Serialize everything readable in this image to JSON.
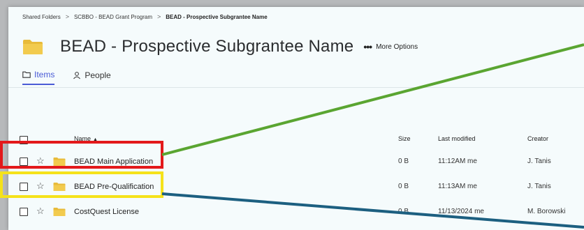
{
  "breadcrumb": {
    "items": [
      "Shared Folders",
      "SCBBO - BEAD Grant Program",
      "BEAD - Prospective Subgrantee Name"
    ],
    "separator": ">"
  },
  "title": "BEAD - Prospective Subgrantee Name",
  "more_options": {
    "dots": "•••",
    "label": "More Options"
  },
  "tabs": [
    {
      "label": "Items",
      "icon": "folder-outline-icon",
      "active": true
    },
    {
      "label": "People",
      "icon": "person-icon",
      "active": false
    }
  ],
  "table": {
    "columns": {
      "name": "Name",
      "sort_indicator": "▲",
      "size": "Size",
      "modified": "Last modified",
      "creator": "Creator"
    },
    "rows": [
      {
        "name": "BEAD Main Application",
        "size": "0 B",
        "modified": "11:12AM me",
        "creator": "J. Tanis"
      },
      {
        "name": "BEAD Pre-Qualification",
        "size": "0 B",
        "modified": "11:13AM me",
        "creator": "J. Tanis"
      },
      {
        "name": "CostQuest License",
        "size": "0 B",
        "modified": "11/13/2024 me",
        "creator": "M. Borowski"
      }
    ]
  },
  "icons": {
    "star": "☆"
  },
  "colors": {
    "accent": "#4a5bd6",
    "folder": "#e8bb3a",
    "highlight_red": "#e3191b",
    "highlight_yellow": "#f5e21a",
    "line_green": "#5aa531",
    "line_teal": "#1c5f80"
  }
}
